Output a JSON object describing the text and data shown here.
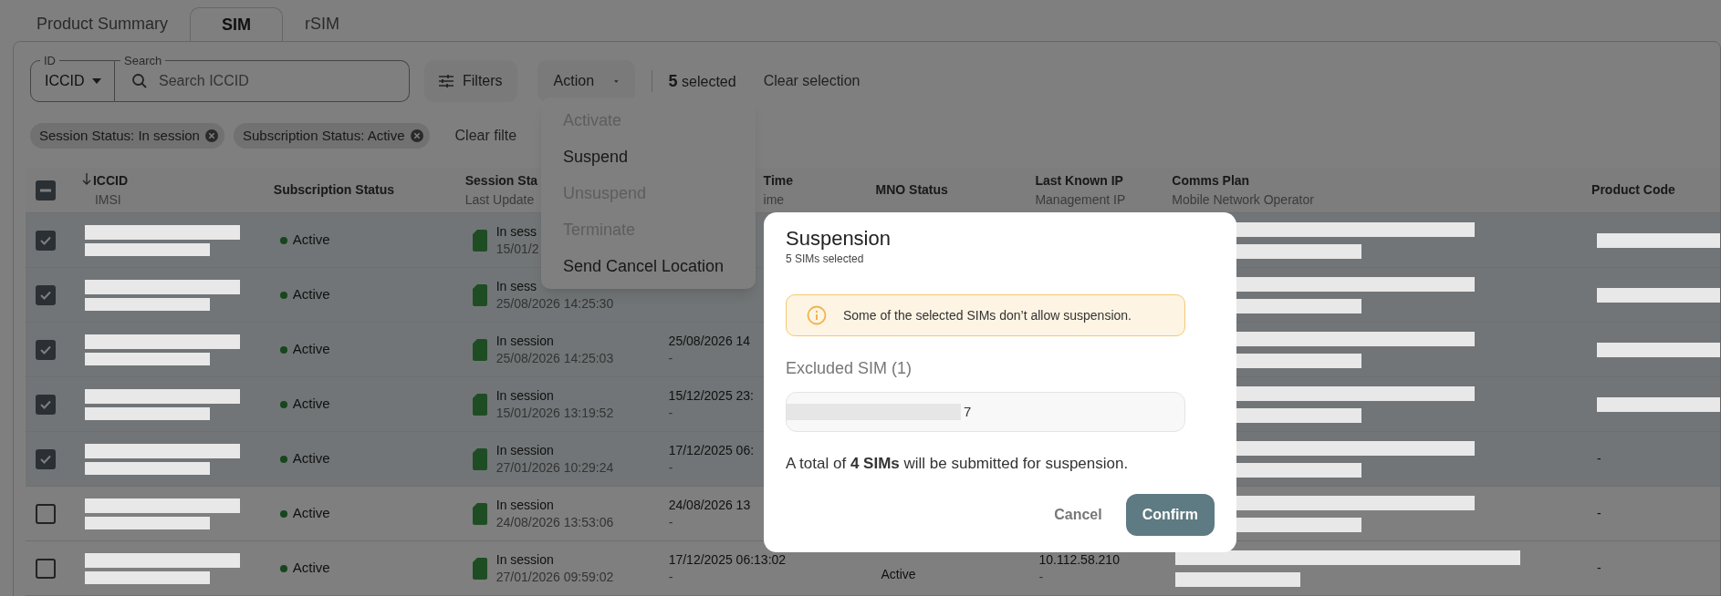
{
  "tabs": [
    {
      "label": "Product Summary",
      "selected": false
    },
    {
      "label": "SIM",
      "selected": true
    },
    {
      "label": "rSIM",
      "selected": false
    }
  ],
  "toolbar": {
    "id_select": {
      "label": "ID",
      "value": "ICCID"
    },
    "search": {
      "label": "Search",
      "placeholder": "Search ICCID"
    },
    "filters_button": "Filters",
    "action_button": "Action",
    "selection_count": "5",
    "selection_label": "selected",
    "clear_selection": "Clear selection"
  },
  "filter_chips": [
    "Session Status: In session",
    "Subscription Status: Active"
  ],
  "clear_filters": "Clear filte",
  "action_menu": [
    {
      "label": "Activate",
      "disabled": true
    },
    {
      "label": "Suspend",
      "disabled": false
    },
    {
      "label": "Unsuspend",
      "disabled": true
    },
    {
      "label": "Terminate",
      "disabled": true
    },
    {
      "label": "Send Cancel Location",
      "disabled": false
    }
  ],
  "table": {
    "header_checkbox_indeterminate": true,
    "columns": [
      {
        "title": "ICCID",
        "subtitle": "IMSI",
        "sorted": true
      },
      {
        "title": "Subscription Status",
        "sorted": false
      },
      {
        "title": "Session Sta",
        "subtitle": "Last Update",
        "sorted": false
      },
      {
        "title": "Time",
        "subtitle": "ime",
        "sorted": false
      },
      {
        "title": "MNO Status",
        "sorted": false
      },
      {
        "title": "Last Known IP",
        "subtitle": "Management IP",
        "sorted": false
      },
      {
        "title": "Comms Plan",
        "subtitle": "Mobile Network Operator",
        "sorted": false
      },
      {
        "title": "Product Code",
        "sorted": false
      }
    ],
    "rows": [
      {
        "selected": true,
        "subscription": "Active",
        "session_status": "In sess",
        "session_updated": "15/01/2"
      },
      {
        "selected": true,
        "subscription": "Active",
        "session_status": "In sess",
        "session_updated": "25/08/2026 14:25:30"
      },
      {
        "selected": true,
        "subscription": "Active",
        "session_status": "In session",
        "session_updated": "25/08/2026 14:25:03",
        "time": "25/08/2026 14",
        "time_sub": "-"
      },
      {
        "selected": true,
        "subscription": "Active",
        "session_status": "In session",
        "session_updated": "15/01/2026 13:19:52",
        "time": "15/12/2025 23:",
        "time_sub": "-"
      },
      {
        "selected": true,
        "subscription": "Active",
        "session_status": "In session",
        "session_updated": "27/01/2026 10:29:24",
        "time": "17/12/2025 06:",
        "time_sub": "-",
        "product_code": "-"
      },
      {
        "selected": false,
        "subscription": "Active",
        "session_status": "In session",
        "session_updated": "24/08/2026 13:53:06",
        "time": "24/08/2026 13",
        "time_sub": "-",
        "product_code": "-"
      },
      {
        "selected": false,
        "subscription": "Active",
        "session_status": "In session",
        "session_updated": "27/01/2026 09:59:02",
        "time": "17/12/2025 06:13:02",
        "time_sub": "-",
        "mno": "Active",
        "ip": "10.112.58.210",
        "ip_sub": "-",
        "product_code": "-"
      }
    ]
  },
  "dialog": {
    "title": "Suspension",
    "subtitle": "5 SIMs selected",
    "warning": "Some of the selected SIMs don’t allow suspension.",
    "excluded_label": "Excluded SIM (1)",
    "excluded_value": "7",
    "summary": "A total of **4 SIMs** will be submitted for suspension.",
    "buttons": [
      {
        "label": "Cancel",
        "kind": "text"
      },
      {
        "label": "Confirm",
        "kind": "primary"
      }
    ]
  }
}
